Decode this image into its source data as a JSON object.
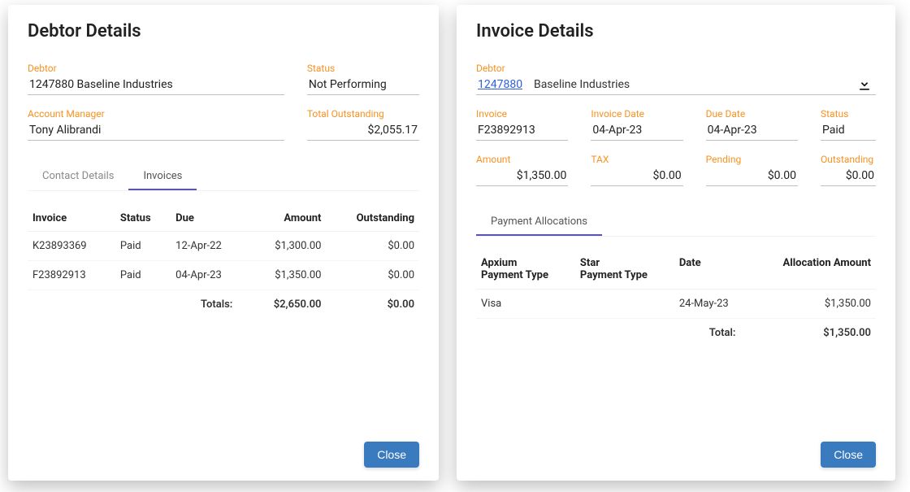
{
  "debtor_dialog": {
    "title": "Debtor Details",
    "labels": {
      "debtor": "Debtor",
      "status": "Status",
      "account_manager": "Account Manager",
      "total_outstanding": "Total Outstanding"
    },
    "debtor_code": "1247880",
    "debtor_name": "Baseline Industries",
    "debtor_full": "1247880  Baseline Industries",
    "status": "Not Performing",
    "account_manager": "Tony Alibrandi",
    "total_outstanding": "$2,055.17",
    "tabs": {
      "contact": "Contact Details",
      "invoices": "Invoices"
    },
    "active_tab": "invoices",
    "cols": {
      "invoice": "Invoice",
      "status": "Status",
      "due": "Due",
      "amount": "Amount",
      "outstanding": "Outstanding"
    },
    "rows": [
      {
        "invoice": "K23893369",
        "status": "Paid",
        "due": "12-Apr-22",
        "amount": "$1,300.00",
        "outstanding": "$0.00"
      },
      {
        "invoice": "F23892913",
        "status": "Paid",
        "due": "04-Apr-23",
        "amount": "$1,350.00",
        "outstanding": "$0.00"
      }
    ],
    "totals": {
      "label": "Totals:",
      "amount": "$2,650.00",
      "outstanding": "$0.00"
    },
    "close_label": "Close"
  },
  "invoice_dialog": {
    "title": "Invoice Details",
    "labels": {
      "debtor": "Debtor",
      "invoice": "Invoice",
      "invoice_date": "Invoice Date",
      "due_date": "Due Date",
      "status": "Status",
      "amount": "Amount",
      "tax": "TAX",
      "pending": "Pending",
      "outstanding": "Outstanding"
    },
    "debtor_code": "1247880",
    "debtor_name": "Baseline Industries",
    "invoice": "F23892913",
    "invoice_date": "04-Apr-23",
    "due_date": "04-Apr-23",
    "status": "Paid",
    "amount": "$1,350.00",
    "tax": "$0.00",
    "pending": "$0.00",
    "outstanding": "$0.00",
    "tab_allocations": "Payment Allocations",
    "alloc_cols": {
      "apxium_type": "Apxium\nPayment Type",
      "star_type": "Star\nPayment Type",
      "date": "Date",
      "alloc_amount": "Allocation Amount"
    },
    "alloc_rows": [
      {
        "apxium_type": "Visa",
        "star_type": "",
        "date": "24-May-23",
        "amount": "$1,350.00"
      }
    ],
    "total": {
      "label": "Total:",
      "amount": "$1,350.00"
    },
    "close_label": "Close"
  }
}
